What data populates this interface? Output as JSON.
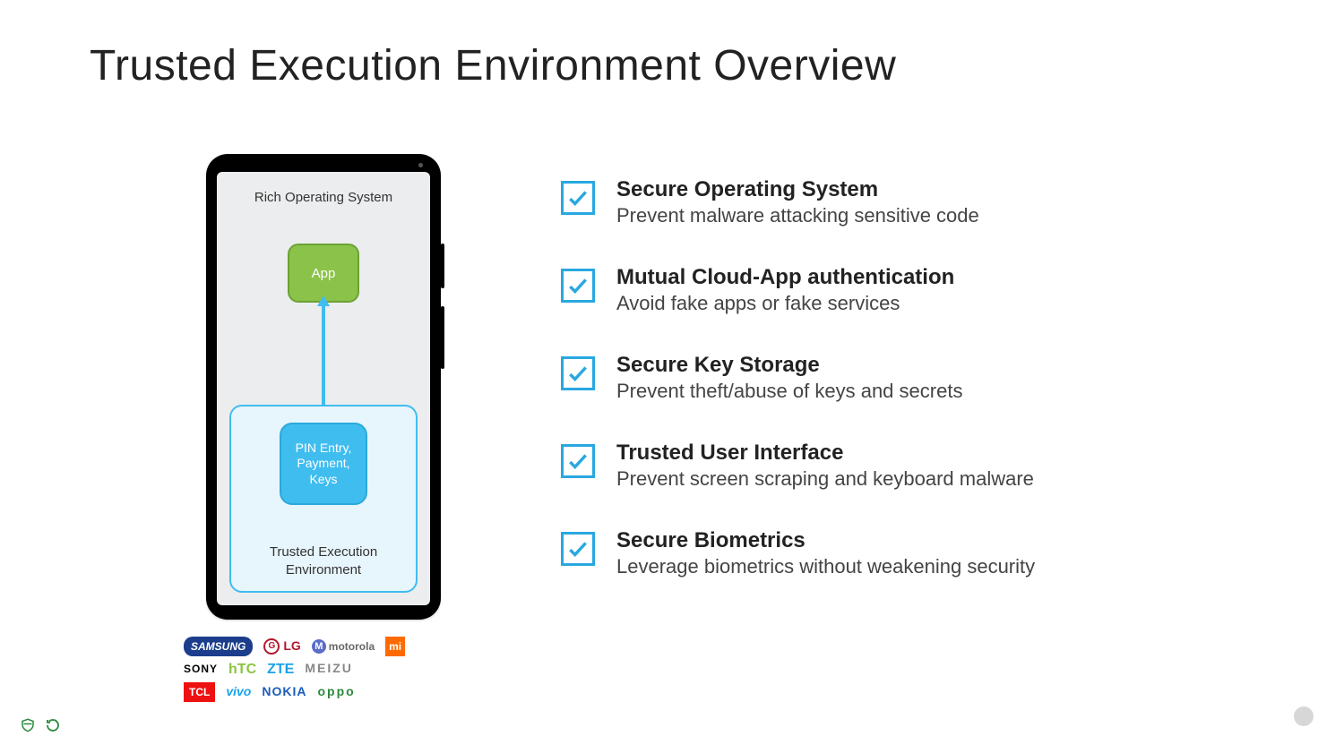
{
  "title": "Trusted Execution Environment Overview",
  "phone": {
    "ros_label": "Rich Operating System",
    "app_label": "App",
    "pin_label": "PIN Entry, Payment, Keys",
    "tee_label": "Trusted Execution Environment"
  },
  "brands": [
    [
      "SAMSUNG",
      "LG",
      "motorola",
      "mi"
    ],
    [
      "SONY",
      "hTC",
      "ZTE",
      "MEIZU"
    ],
    [
      "TCL",
      "vivo",
      "NOKIA",
      "oppo"
    ]
  ],
  "features": [
    {
      "title": "Secure Operating System",
      "desc": "Prevent malware attacking sensitive code"
    },
    {
      "title": "Mutual Cloud-App authentication",
      "desc": "Avoid fake apps or fake services"
    },
    {
      "title": "Secure Key Storage",
      "desc": "Prevent theft/abuse of keys and secrets"
    },
    {
      "title": "Trusted User Interface",
      "desc": "Prevent screen scraping and keyboard malware"
    },
    {
      "title": "Secure Biometrics",
      "desc": "Leverage biometrics without weakening security"
    }
  ],
  "colors": {
    "accent": "#29a8e0",
    "app": "#8bc24a",
    "tee": "#40bdef"
  }
}
